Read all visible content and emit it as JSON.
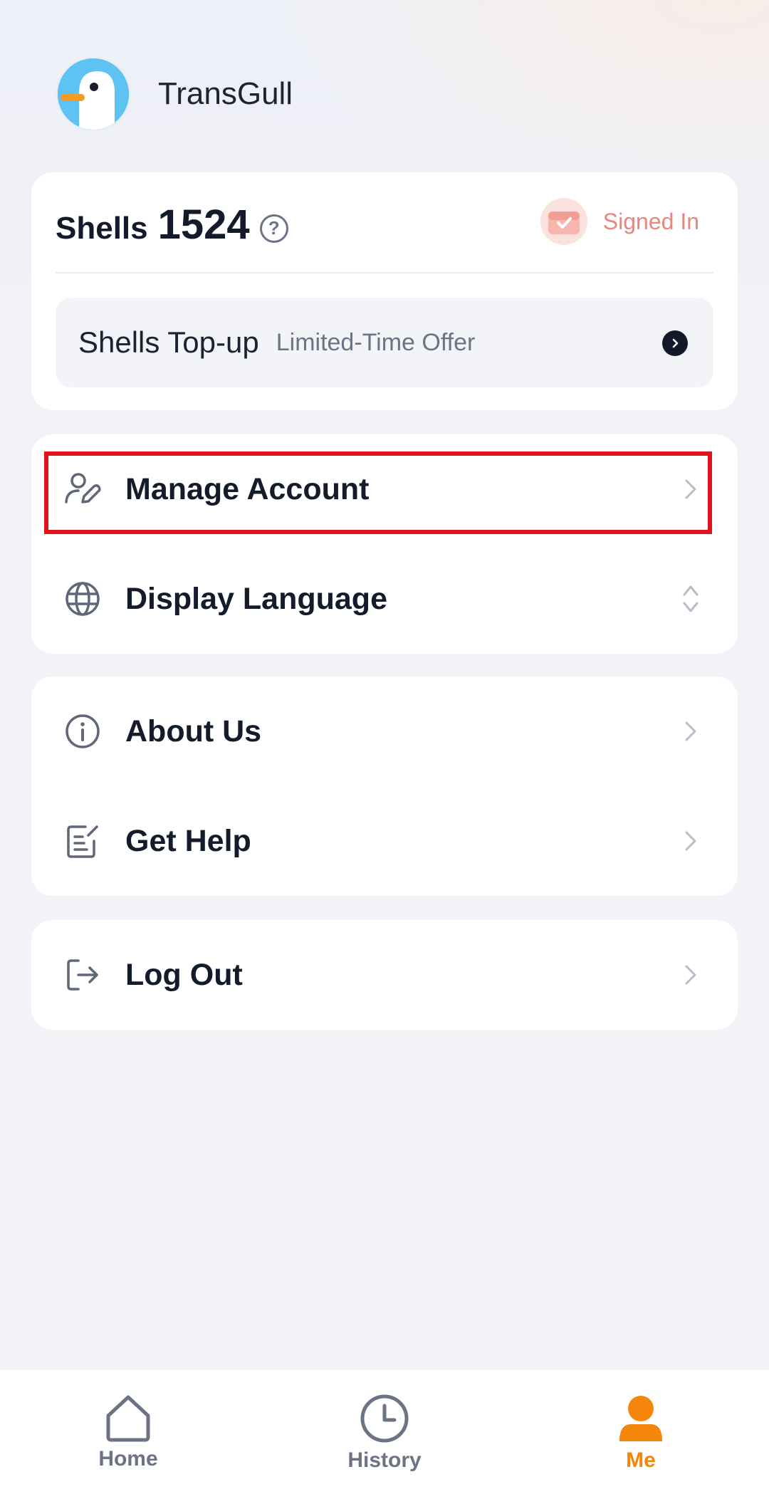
{
  "app": {
    "name": "TransGull"
  },
  "shells": {
    "label": "Shells",
    "count": "1524",
    "help_symbol": "?",
    "signed_in_label": "Signed In",
    "topup_title": "Shells Top-up",
    "topup_subtitle": "Limited-Time Offer"
  },
  "menu": {
    "manage_account": "Manage Account",
    "display_language": "Display Language",
    "about_us": "About Us",
    "get_help": "Get Help",
    "log_out": "Log Out"
  },
  "bottom_nav": {
    "home": "Home",
    "history": "History",
    "me": "Me",
    "active": "me"
  },
  "colors": {
    "accent": "#f3860b",
    "highlight": "#e0141a",
    "avatar_bg": "#5ec3f2",
    "signed_in": "#e8877d"
  },
  "icons": {
    "manage_account": "user-edit-icon",
    "display_language": "globe-icon",
    "about_us": "info-icon",
    "get_help": "edit-note-icon",
    "log_out": "logout-icon"
  }
}
